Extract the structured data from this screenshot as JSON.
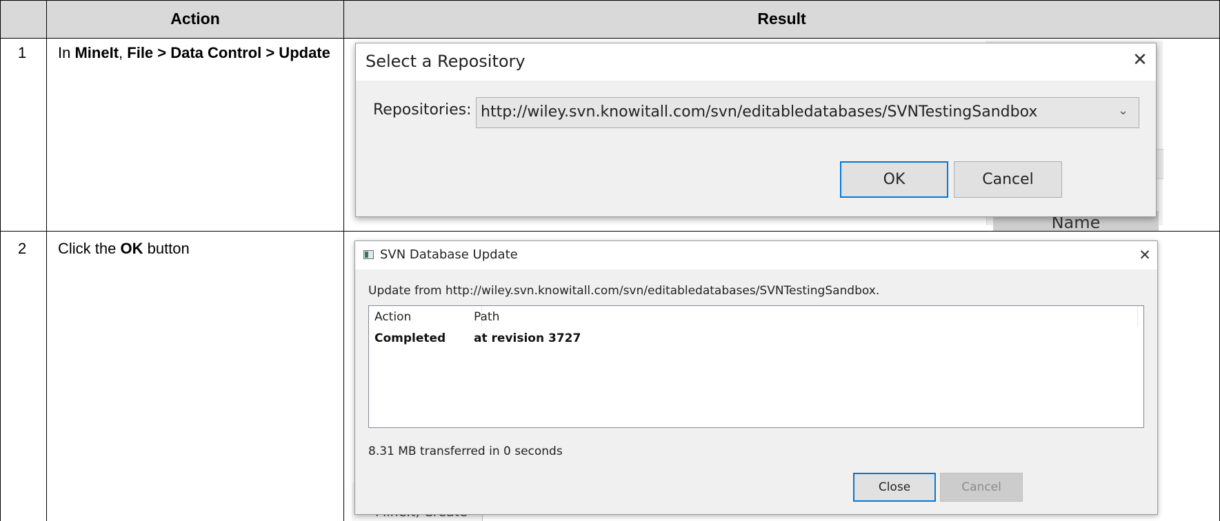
{
  "table": {
    "headers": {
      "num": "",
      "action": "Action",
      "result": "Result"
    },
    "rows": [
      {
        "num": "1",
        "action_parts": [
          "In ",
          "MineIt",
          ", ",
          "File > Data Control > Update"
        ]
      },
      {
        "num": "2",
        "action_parts": [
          "Click the ",
          "OK",
          " button"
        ]
      }
    ]
  },
  "step1_screenshot": {
    "dialog_title": "Select a Repository",
    "close_glyph": "✕",
    "repositories_label": "Repositories:",
    "repositories_value": "http://wiley.svn.knowitall.com/svn/editabledatabases/SVNTestingSandbox",
    "ok_label": "OK",
    "cancel_label": "Cancel",
    "background_column_label": "Name"
  },
  "step2_screenshot": {
    "dialog_title": "SVN Database Update",
    "close_glyph": "✕",
    "update_from_text": "Update from http://wiley.svn.knowitall.com/svn/editabledatabases/SVNTestingSandbox.",
    "list": {
      "columns": [
        "Action",
        "Path"
      ],
      "rows": [
        {
          "action": "Completed",
          "path": "at revision 3727"
        }
      ]
    },
    "transferred_text": "8.31 MB transferred in 0 seconds",
    "close_label": "Close",
    "cancel_label": "Cancel",
    "background_menu_text": "MineIt, Create"
  },
  "colors": {
    "header_bg": "#d9d9d9",
    "dialog_bg": "#f0f0f0",
    "focus_border": "#0078d7"
  }
}
